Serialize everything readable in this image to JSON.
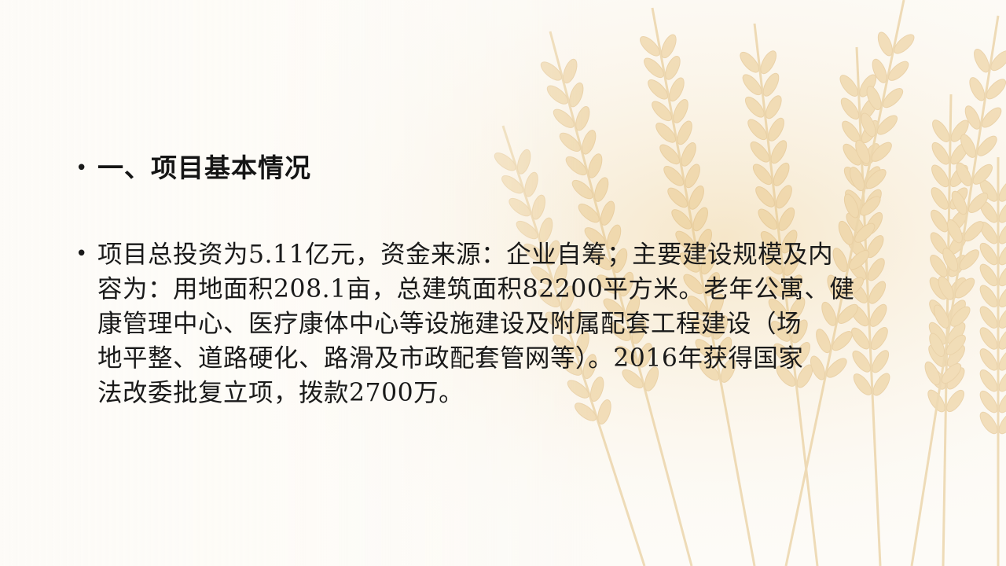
{
  "heading": "一、项目基本情况",
  "bullet_symbol": "•",
  "body_lines": [
    "项目总投资为5.11亿元，资金来源：企业自筹；主要建设规模及内",
    "容为：用地面积208.1亩，总建筑面积82200平方米。老年公寓、健",
    "康管理中心、医疗康体中心等设施建设及附属配套工程建设（场",
    "地平整、道路硬化、路滑及市政配套管网等）。2016年获得国家",
    "法改委批复立项，拨款2700万。"
  ],
  "colors": {
    "text": "#1a1a1a",
    "wheat": "#e8c98f",
    "background": "#fdfbf7"
  },
  "background_image": "wheat-ears-illustration"
}
